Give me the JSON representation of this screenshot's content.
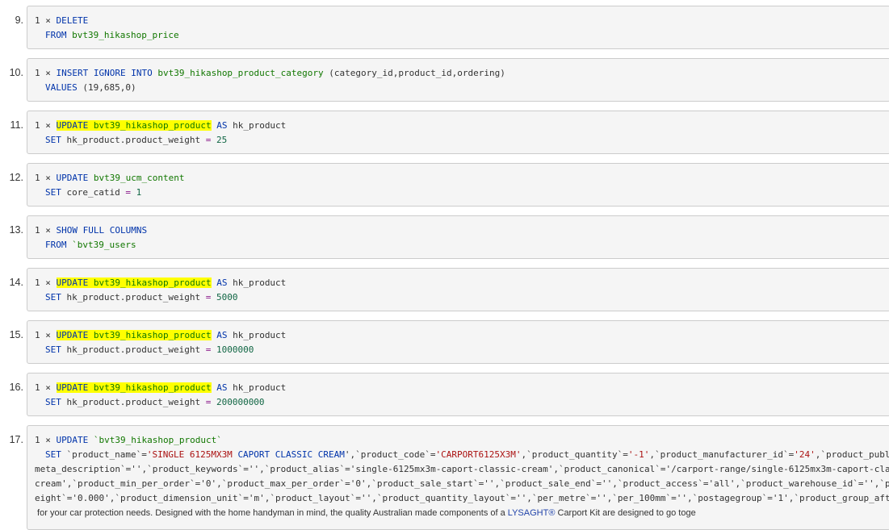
{
  "queries": [
    {
      "number": "9.",
      "count": "1 ×",
      "line1_kw": "DELETE",
      "line2_kw": "FROM",
      "line2_table": "bvt39_hikashop_price"
    },
    {
      "number": "10.",
      "count": "1 ×",
      "line1_kw": "INSERT IGNORE INTO",
      "line1_table": "bvt39_hikashop_product_category",
      "line1_rest": "(category_id,product_id,ordering)",
      "line2_kw": "VALUES",
      "line2_rest": "(19,685,0)"
    },
    {
      "number": "11.",
      "count": "1 ×",
      "line1_kw": "UPDATE",
      "line1_table": "bvt39_hikashop_product",
      "line1_as": "AS",
      "line1_alias": "hk_product",
      "line2_kw": "SET",
      "line2_field": "hk_product.product_weight",
      "line2_eq": "=",
      "line2_value": "25"
    },
    {
      "number": "12.",
      "count": "1 ×",
      "line1_kw": "UPDATE",
      "line1_table": "bvt39_ucm_content",
      "line2_kw": "SET",
      "line2_field": "core_catid",
      "line2_eq": "=",
      "line2_value": "1"
    },
    {
      "number": "13.",
      "count": "1 ×",
      "line1_kw": "SHOW FULL COLUMNS",
      "line2_kw": "FROM",
      "line2_table": "`bvt39_users"
    },
    {
      "number": "14.",
      "count": "1 ×",
      "line1_kw": "UPDATE",
      "line1_table": "bvt39_hikashop_product",
      "line1_as": "AS",
      "line1_alias": "hk_product",
      "line2_kw": "SET",
      "line2_field": "hk_product.product_weight",
      "line2_eq": "=",
      "line2_value": "5000"
    },
    {
      "number": "15.",
      "count": "1 ×",
      "line1_kw": "UPDATE",
      "line1_table": "bvt39_hikashop_product",
      "line1_as": "AS",
      "line1_alias": "hk_product",
      "line2_kw": "SET",
      "line2_field": "hk_product.product_weight",
      "line2_eq": "=",
      "line2_value": "1000000"
    },
    {
      "number": "16.",
      "count": "1 ×",
      "line1_kw": "UPDATE",
      "line1_table": "bvt39_hikashop_product",
      "line1_as": "AS",
      "line1_alias": "hk_product",
      "line2_kw": "SET",
      "line2_field": "hk_product.product_weight",
      "line2_eq": "=",
      "line2_value": "200000000"
    },
    {
      "number": "17.",
      "count": "1 ×",
      "line1_kw": "UPDATE",
      "line1_table": "`bvt39_hikashop_product`",
      "line2_kw": "SET",
      "line2_a": "`product_name`=",
      "line2_b": "'SINGLE",
      "line2_c": "6125MX3M",
      "line2_d": "CAPORT CLASSIC CREAM",
      "line2_e": "',`product_code`=",
      "line2_f": "'CARPORT6125X3M'",
      "line2_g": ",`product_quantity`=",
      "line2_h": "'-1'",
      "line2_i": ",`product_manufacturer_id`=",
      "line2_j": "'24'",
      "line2_k": ",`product_publi",
      "line3": "meta_description`='',`product_keywords`='',`product_alias`='single-6125mx3m-caport-classic-cream',`product_canonical`='/carport-range/single-6125mx3m-caport-clas",
      "line4": "cream',`product_min_per_order`='0',`product_max_per_order`='0',`product_sale_start`='',`product_sale_end`='',`product_access`='all',`product_warehouse_id`='',`pr",
      "line5": "eight`='0.000',`product_dimension_unit`='m',`product_layout`='',`product_quantity_layout`='',`per_metre`='',`per_100mm`='',`postagegroup`='1',`product_group_afte",
      "line6_a": " for your car protection needs. Designed with the home handyman in mind, the quality Australian made components of a",
      "line6_b": "LYSAGHT®",
      "line6_c": "Carport Kit are designed to go toge"
    }
  ]
}
